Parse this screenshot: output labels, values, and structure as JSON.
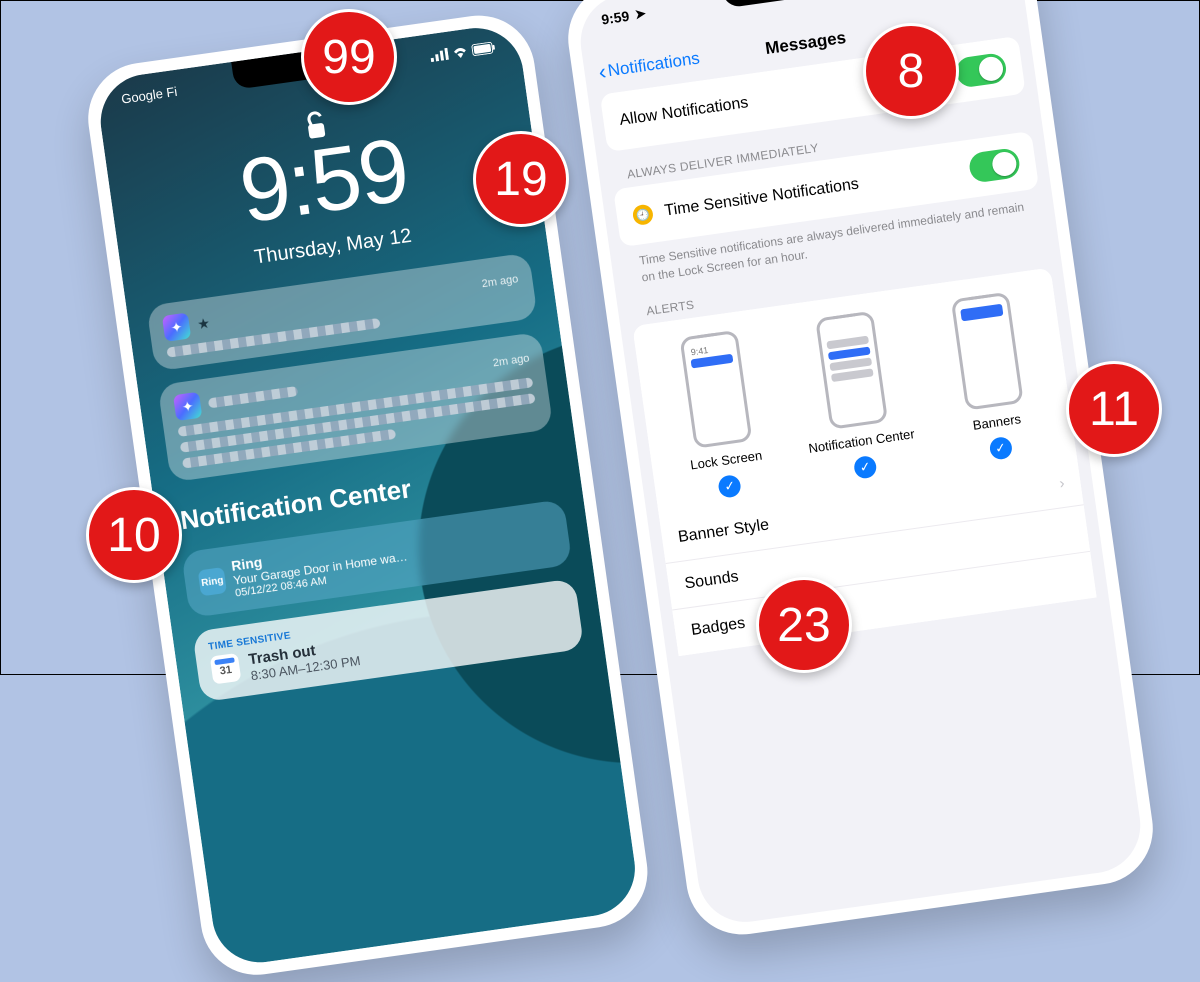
{
  "callouts": {
    "c99": "99",
    "c19": "19",
    "c8": "8",
    "c11": "11",
    "c23": "23",
    "c10": "10"
  },
  "left": {
    "carrier": "Google Fi",
    "clock": "9:59",
    "date": "Thursday, May 12",
    "notif1": {
      "time": "2m ago"
    },
    "notif2": {
      "time": "2m ago"
    },
    "nc_heading": "Notification Center",
    "ring": {
      "app": "Ring",
      "title": "Ring",
      "body": "Your Garage Door in Home wa…",
      "ts": "05/12/22 08:46 AM"
    },
    "ts": {
      "tag": "TIME SENSITIVE",
      "title": "Trash out",
      "sub": "8:30 AM–12:30 PM",
      "cal": "31"
    }
  },
  "right": {
    "clock": "9:59",
    "back": "Notifications",
    "title": "Messages",
    "allow": "Allow Notifications",
    "sect_always": "ALWAYS DELIVER IMMEDIATELY",
    "timesens": "Time Sensitive Notifications",
    "hint": "Time Sensitive notifications are always delivered immediately and remain on the Lock Screen for an hour.",
    "sect_alerts": "ALERTS",
    "alert1": "Lock Screen",
    "alert2": "Notification Center",
    "alert3": "Banners",
    "mini_time": "9:41",
    "row_banner": "Banner Style",
    "row_sounds": "Sounds",
    "row_badges": "Badges"
  }
}
